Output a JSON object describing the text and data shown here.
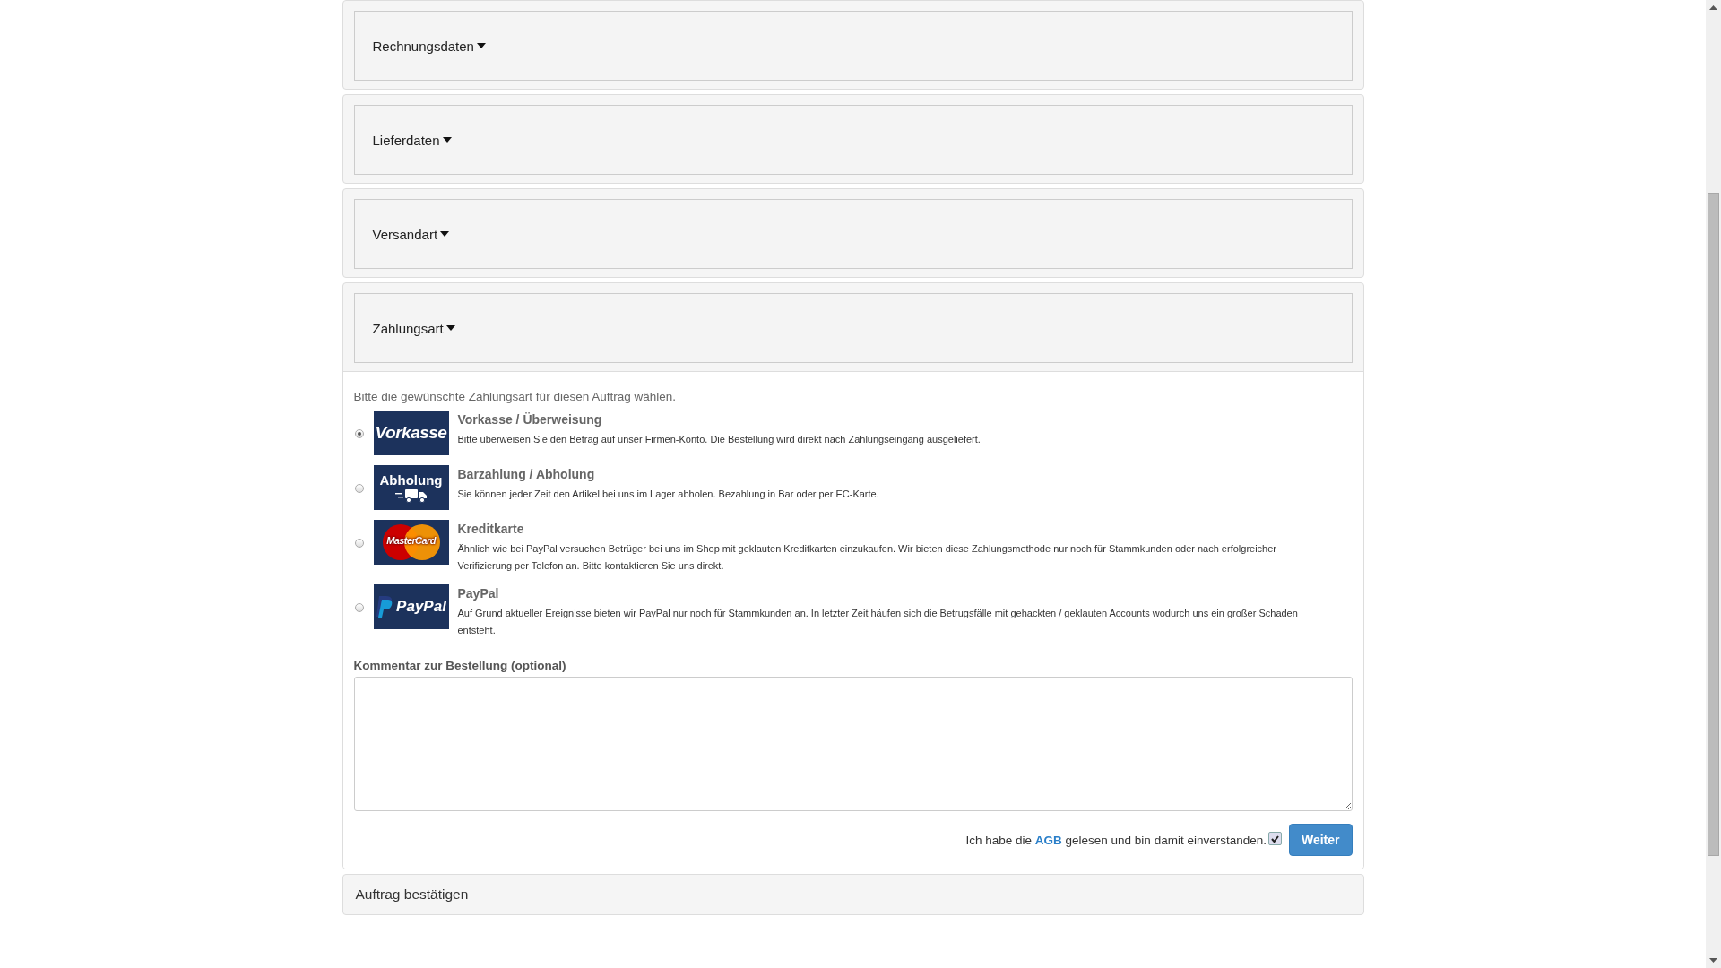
{
  "sections": [
    {
      "title": "Rechnungsdaten",
      "expanded": false
    },
    {
      "title": "Lieferdaten",
      "expanded": false
    },
    {
      "title": "Versandart",
      "expanded": false
    },
    {
      "title": "Zahlungsart",
      "expanded": true
    }
  ],
  "payment": {
    "intro": "Bitte die gewünschte Zahlungsart für diesen Auftrag wählen.",
    "options": [
      {
        "kind": "vorkasse",
        "logo_text": "Vorkasse",
        "name": "Vorkasse / Überweisung",
        "description": "Bitte überweisen Sie den Betrag auf unser Firmen-Konto. Die Bestellung wird direkt nach Zahlungseingang ausgeliefert.",
        "selected": true
      },
      {
        "kind": "pickup",
        "logo_text": "Abholung",
        "name": "Barzahlung / Abholung",
        "description": "Sie können jeder Zeit den Artikel bei uns im Lager abholen. Bezahlung in Bar oder per EC-Karte.",
        "selected": false
      },
      {
        "kind": "card",
        "logo_text": "MasterCard",
        "name": "Kreditkarte",
        "description": "Ähnlich wie bei PayPal versuchen Betrüger bei uns im Shop mit geklauten Kreditkarten einzukaufen. Wir bieten diese Zahlungsmethode nur noch für Stammkunden oder nach erfolgreicher Verifizierung per Telefon an. Bitte kontaktieren Sie uns direkt.",
        "selected": false
      },
      {
        "kind": "paypal",
        "logo_text": "PayPal",
        "name": "PayPal",
        "description": "Auf Grund aktueller Ereignisse bieten wir PayPal nur noch für Stammkunden an. In letzter Zeit häufen sich die Betrugsfälle mit gehackten / geklauten Accounts wodurch uns ein großer Schaden entsteht.",
        "selected": false
      }
    ],
    "comment_label": "Kommentar zur Bestellung (optional)",
    "agreement": {
      "text_before": "Ich habe die",
      "link": "AGB",
      "text_after": "gelesen und bin damit einverstanden.",
      "checked": true
    },
    "submit": "Weiter"
  },
  "next_step": {
    "title": "Auftrag bestätigen"
  }
}
